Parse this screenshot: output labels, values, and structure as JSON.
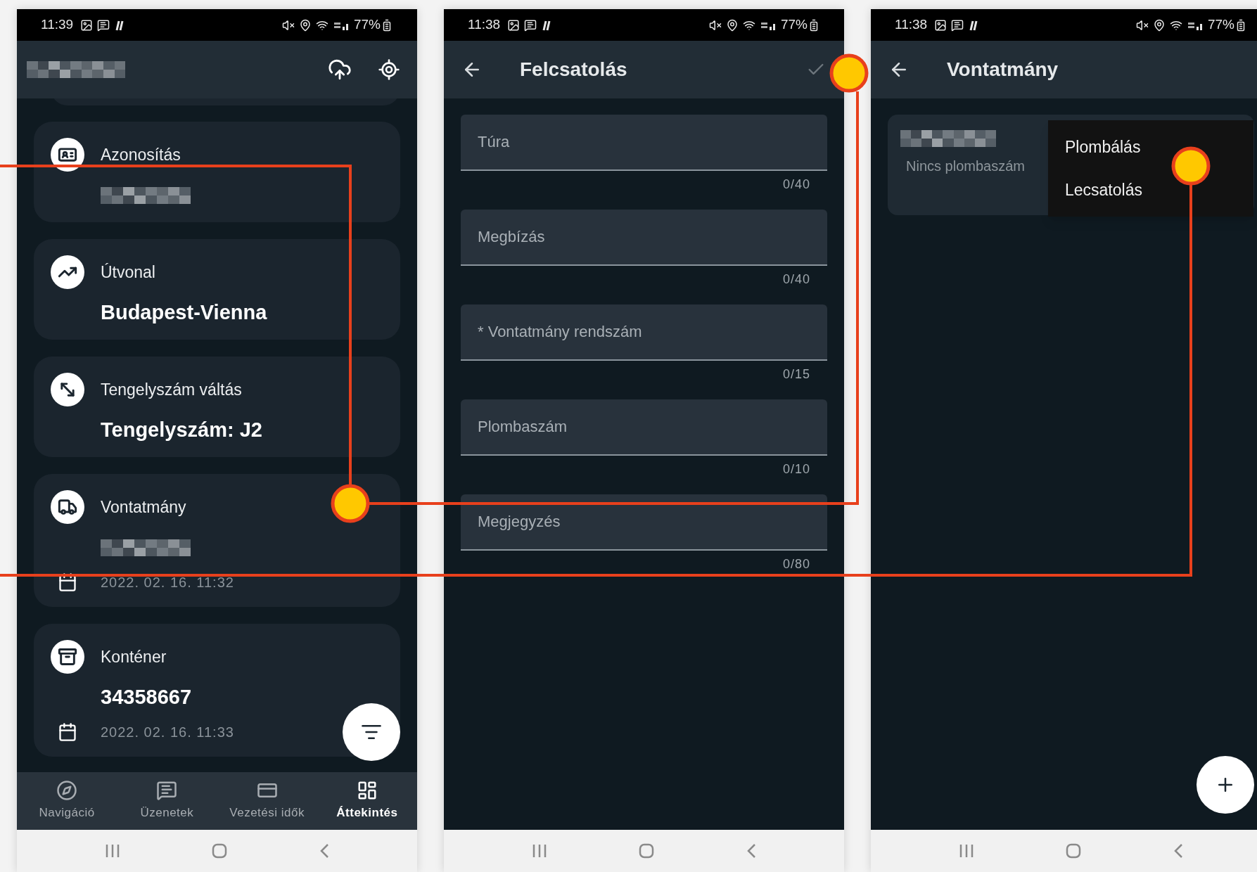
{
  "screens": [
    {
      "kind": "overview",
      "status_bar": {
        "time": "11:39",
        "battery": "77%"
      },
      "app_bar": {
        "title_redacted": true
      },
      "cards": [
        {
          "title": "Azonosítás",
          "value_redacted": true
        },
        {
          "title": "Útvonal",
          "value": "Budapest-Vienna"
        },
        {
          "title": "Tengelyszám váltás",
          "value": "Tengelyszám: J2"
        },
        {
          "title": "Vontatmány",
          "value_redacted": true,
          "date": "2022. 02. 16. 11:32"
        },
        {
          "title": "Konténer",
          "value": "34358667",
          "date": "2022. 02. 16. 11:33"
        }
      ],
      "nav": [
        {
          "label": "Navigáció",
          "selected": false
        },
        {
          "label": "Üzenetek",
          "selected": false
        },
        {
          "label": "Vezetési idők",
          "selected": false
        },
        {
          "label": "Áttekintés",
          "selected": true
        }
      ]
    },
    {
      "kind": "form",
      "status_bar": {
        "time": "11:38",
        "battery": "77%"
      },
      "app_bar": {
        "title": "Felcsatolás"
      },
      "fields": [
        {
          "placeholder": "Túra",
          "counter": "0/40"
        },
        {
          "placeholder": "Megbízás",
          "counter": "0/40"
        },
        {
          "placeholder": "* Vontatmány rendszám",
          "counter": "0/15"
        },
        {
          "placeholder": "Plombaszám",
          "counter": "0/10"
        },
        {
          "placeholder": "Megjegyzés",
          "counter": "0/80"
        }
      ]
    },
    {
      "kind": "detail",
      "status_bar": {
        "time": "11:38",
        "battery": "77%"
      },
      "app_bar": {
        "title": "Vontatmány"
      },
      "item": {
        "title_redacted": true,
        "subtitle": "Nincs plombaszám"
      },
      "menu": [
        "Plombálás",
        "Lecsatolás"
      ]
    }
  ]
}
